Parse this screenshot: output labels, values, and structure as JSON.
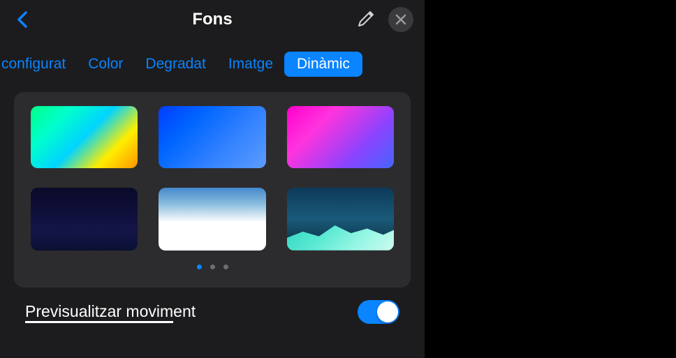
{
  "header": {
    "title": "Fons"
  },
  "tabs": {
    "items": [
      {
        "label": "configurat"
      },
      {
        "label": "Color"
      },
      {
        "label": "Degradat"
      },
      {
        "label": "Imatge"
      },
      {
        "label": "Dinàmic"
      }
    ],
    "active_index": 4
  },
  "pagination": {
    "total": 3,
    "active": 0
  },
  "toggle": {
    "label": "Previsualitzar moviment",
    "state": true
  },
  "thumbnails": [
    {
      "name": "gradient-green-yellow"
    },
    {
      "name": "gradient-blue"
    },
    {
      "name": "gradient-pink-blue"
    },
    {
      "name": "dark-navy"
    },
    {
      "name": "cloud-white-blue"
    },
    {
      "name": "teal-mountains"
    }
  ]
}
